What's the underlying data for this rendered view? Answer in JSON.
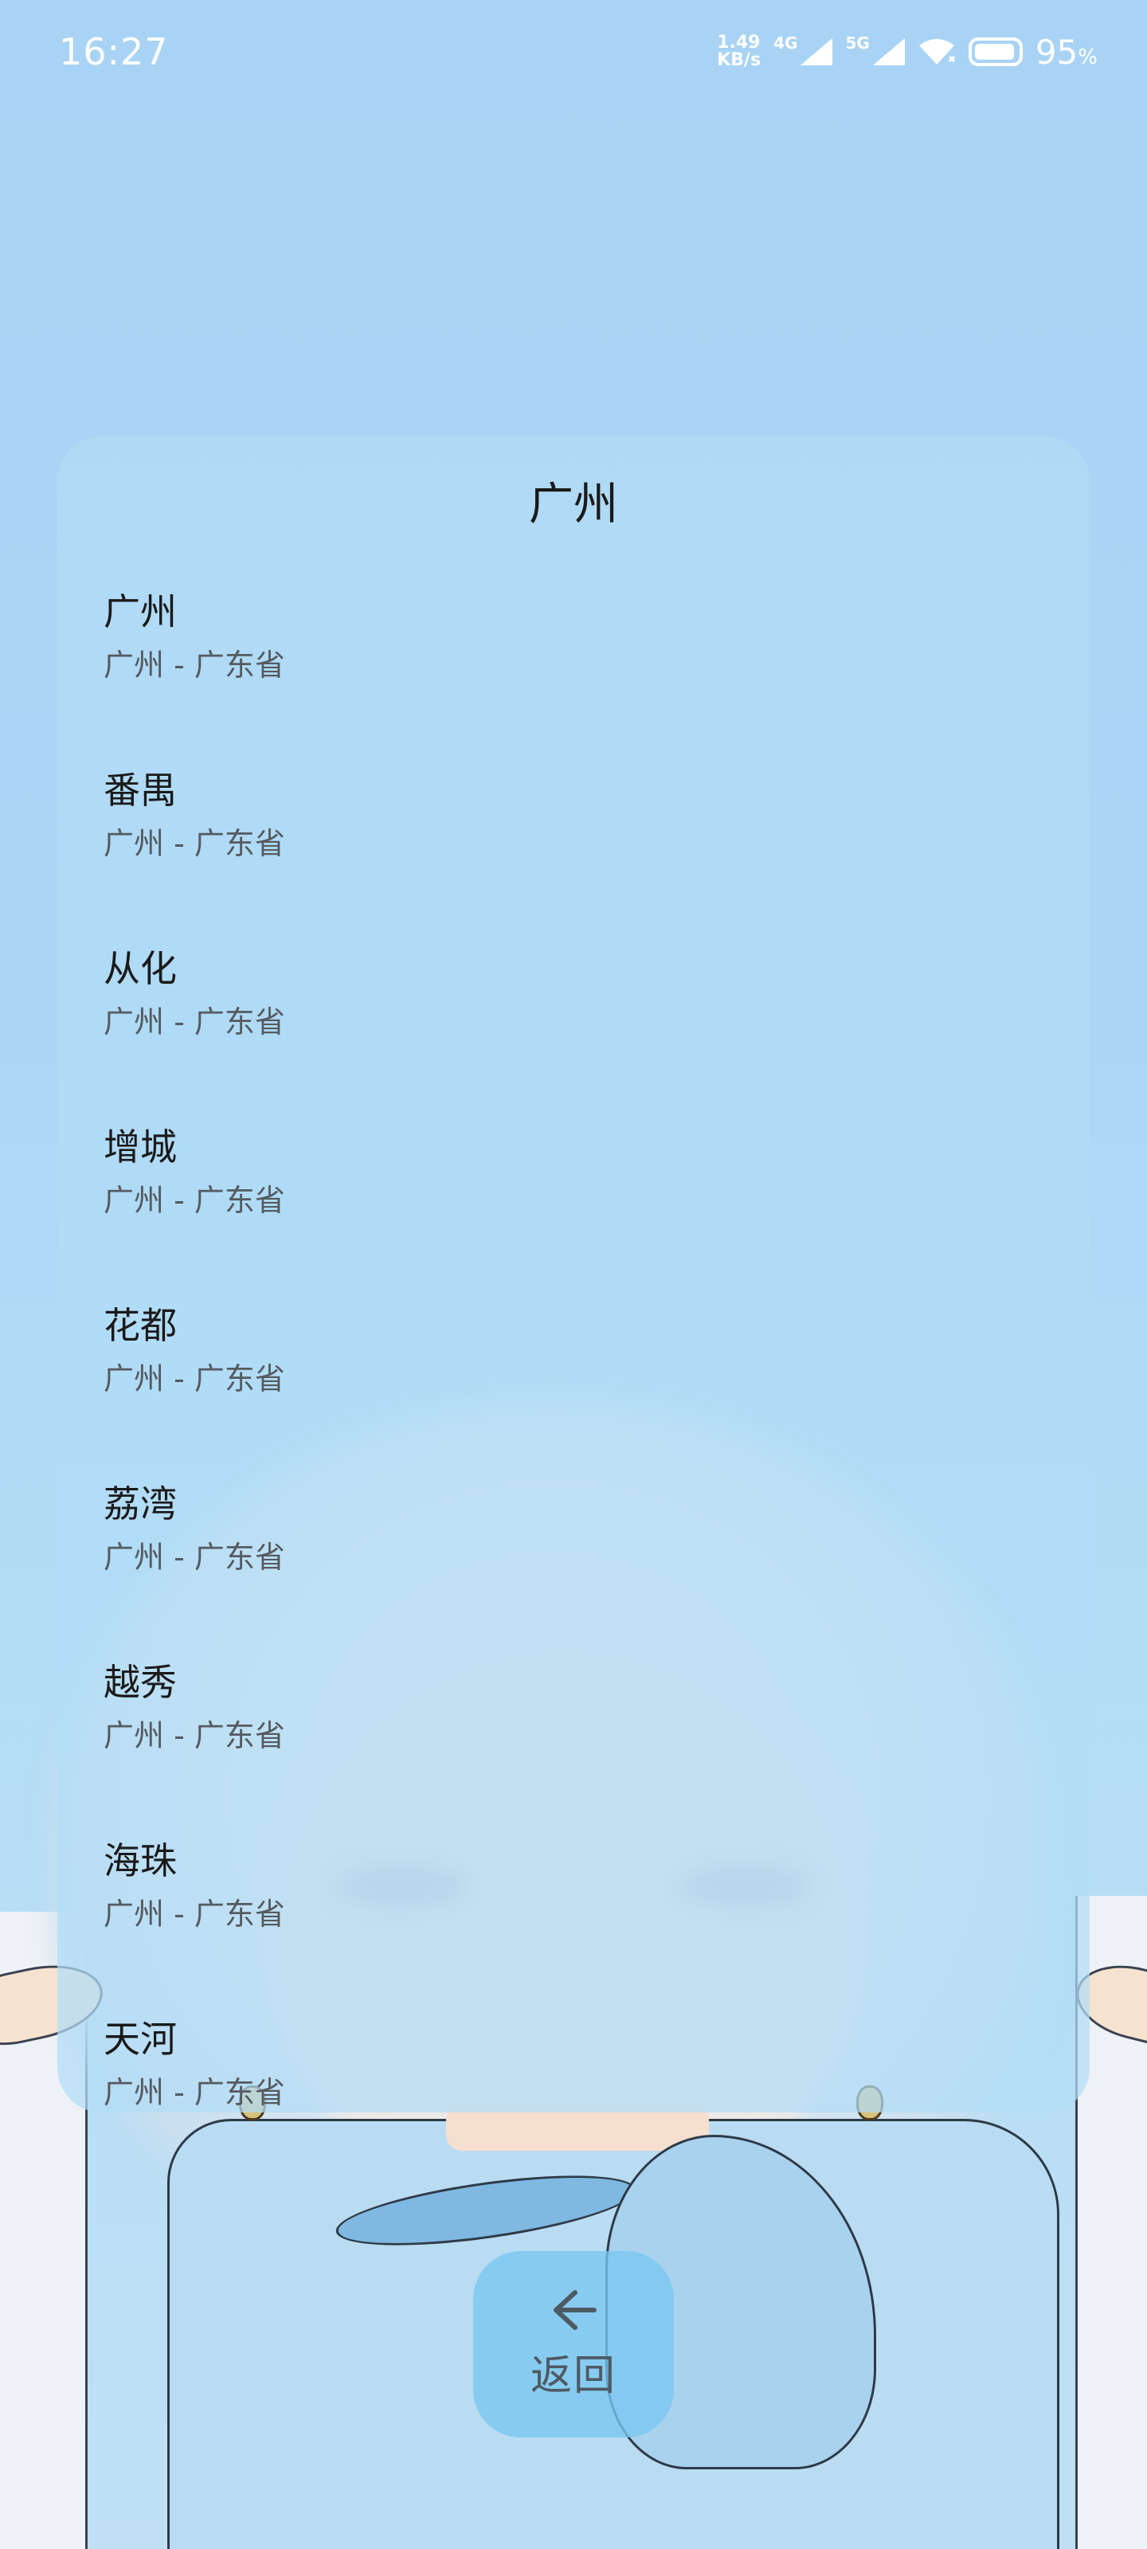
{
  "status_bar": {
    "time": "16:27",
    "net_speed_value": "1.49",
    "net_speed_unit": "KB/s",
    "signal_1_label": "4G",
    "signal_2_label": "5G",
    "battery_percent": "95",
    "battery_percent_sign": "%"
  },
  "card": {
    "title": "广州",
    "items": [
      {
        "name": "广州",
        "sub": "广州 - 广东省"
      },
      {
        "name": "番禺",
        "sub": "广州 - 广东省"
      },
      {
        "name": "从化",
        "sub": "广州 - 广东省"
      },
      {
        "name": "增城",
        "sub": "广州 - 广东省"
      },
      {
        "name": "花都",
        "sub": "广州 - 广东省"
      },
      {
        "name": "荔湾",
        "sub": "广州 - 广东省"
      },
      {
        "name": "越秀",
        "sub": "广州 - 广东省"
      },
      {
        "name": "海珠",
        "sub": "广州 - 广东省"
      },
      {
        "name": "天河",
        "sub": "广州 - 广东省"
      }
    ]
  },
  "back_button": {
    "label": "返回",
    "icon": "arrow-left-icon"
  },
  "colors": {
    "background": "#acd6f6",
    "card": "#b2dcf7",
    "back_button": "#78c6f0",
    "text_primary": "#1a1a1a",
    "text_secondary": "#555b60"
  }
}
